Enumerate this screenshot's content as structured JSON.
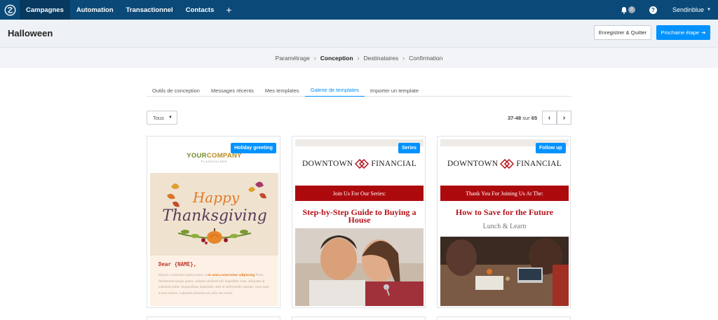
{
  "nav": {
    "items": [
      {
        "label": "Campagnes",
        "active": true
      },
      {
        "label": "Automation",
        "active": false
      },
      {
        "label": "Transactionnel",
        "active": false
      },
      {
        "label": "Contacts",
        "active": false
      }
    ],
    "plus": "+",
    "notif_count": "0",
    "help": "?",
    "account": "Sendinblue"
  },
  "header": {
    "title": "Halloween",
    "save_label": "Enregistrer & Quitter",
    "next_label": "Prochaine étape"
  },
  "breadcrumb": [
    "Paramétrage",
    "Conception",
    "Destinataires",
    "Confirmation"
  ],
  "tabs": [
    {
      "label": "Outils de conception",
      "active": false
    },
    {
      "label": "Messages récents",
      "active": false
    },
    {
      "label": "Mes templates",
      "active": false
    },
    {
      "label": "Galerie de templates",
      "active": true
    },
    {
      "label": "Importer un template",
      "active": false
    }
  ],
  "filter": {
    "selected": "Tous"
  },
  "pagination": {
    "range": "37-48",
    "of": "sur",
    "total": "65"
  },
  "cards": [
    {
      "badge": "Holiday greeting",
      "company_your": "YOUR",
      "company_name": "COMPANY",
      "company_sub": "PLACEHOLDER",
      "image_line1": "Happy",
      "image_line2": "Thanksgiving",
      "dear": "Dear {NAME},",
      "body_start": "Mauris commodo massa tortor, a ",
      "body_highlight": "sit amet,consectetur adipiscing",
      "body_rest": " Nunc fermentum neque quam, sodales eleifend elit imperdiet vitae. Aliquam id euismod nulla. Suspendisse imperdiet, sem et sollicitudin egestas, urna nunc auctor massa, vulputate pharetra mi odio nec tortor."
    },
    {
      "badge": "Series",
      "brand_left": "DOWNTOWN",
      "brand_right": "FINANCIAL",
      "banner": "Join Us For Our Series:",
      "headline": "Step-by-Step Guide to Buying a House"
    },
    {
      "badge": "Follow up",
      "brand_left": "DOWNTOWN",
      "brand_right": "FINANCIAL",
      "banner": "Thank You For Joining Us At The:",
      "headline": "How to Save for the Future",
      "subline": "Lunch & Learn"
    }
  ],
  "colors": {
    "nav_bg": "#0b4a78",
    "accent": "#0092ff",
    "brand_red": "#ad0a0e"
  }
}
